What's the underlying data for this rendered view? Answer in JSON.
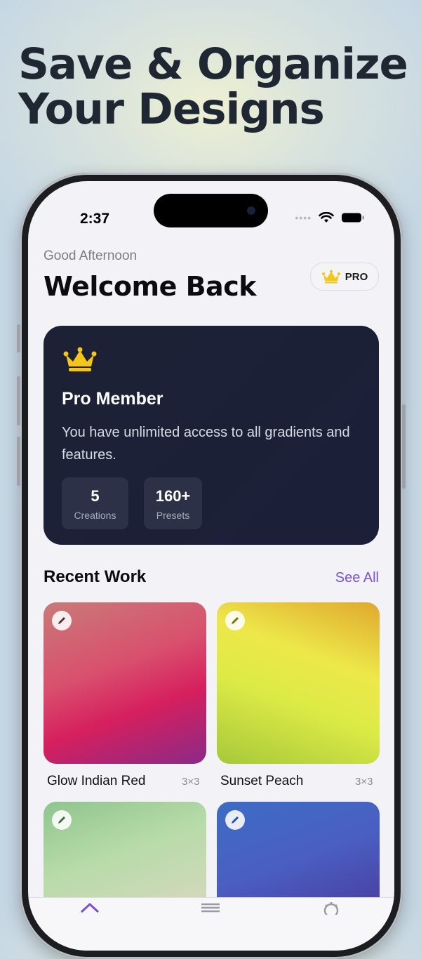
{
  "promo": {
    "line1": "Save & Organize",
    "line2": "Your Designs"
  },
  "status": {
    "time": "2:37"
  },
  "header": {
    "greeting": "Good Afternoon",
    "title": "Welcome Back",
    "badge": "PRO"
  },
  "pro_card": {
    "title": "Pro Member",
    "description": "You have unlimited access to all gradients and features.",
    "stats": [
      {
        "value": "5",
        "label": "Creations"
      },
      {
        "value": "160+",
        "label": "Presets"
      }
    ]
  },
  "recent": {
    "title": "Recent Work",
    "see_all": "See All",
    "items": [
      {
        "name": "Glow Indian Red",
        "size": "3×3"
      },
      {
        "name": "Sunset Peach",
        "size": "3×3"
      },
      {
        "name": "",
        "size": ""
      },
      {
        "name": "",
        "size": ""
      }
    ]
  },
  "tabbar": {
    "icons": [
      "home-icon",
      "layers-icon",
      "gear-icon"
    ]
  },
  "colors": {
    "accent": "#7b4fd8",
    "gold": "#f5c518",
    "card": "#1c2136"
  }
}
